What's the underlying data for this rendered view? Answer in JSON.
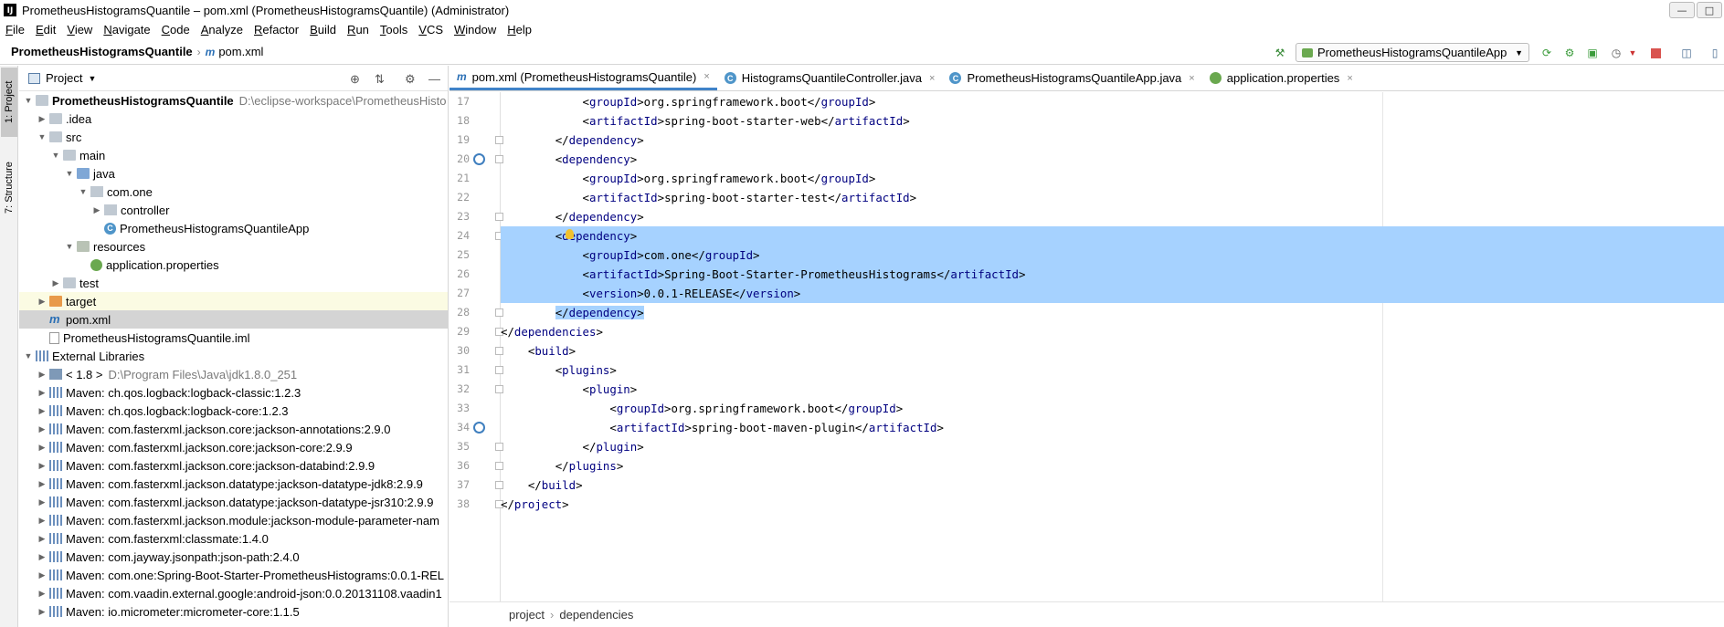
{
  "window": {
    "title": "PrometheusHistogramsQuantile – pom.xml (PrometheusHistogramsQuantile) (Administrator)",
    "minimize": "—",
    "maximize": "□"
  },
  "menu": [
    "File",
    "Edit",
    "View",
    "Navigate",
    "Code",
    "Analyze",
    "Refactor",
    "Build",
    "Run",
    "Tools",
    "VCS",
    "Window",
    "Help"
  ],
  "navbar": {
    "project": "PrometheusHistogramsQuantile",
    "separator": "›",
    "file_icon": "m",
    "file": "pom.xml",
    "run_config": "PrometheusHistogramsQuantileApp"
  },
  "toolbar_icons": [
    "hammer-icon",
    "rerun-icon",
    "debug-icon",
    "coverage-icon",
    "profile-icon",
    "stop-icon",
    "project-structure-icon",
    "terminal-icon"
  ],
  "stripe": {
    "project": "1: Project",
    "structure": "7: Structure"
  },
  "project_panel": {
    "title": "Project",
    "tree": [
      {
        "label": "PrometheusHistogramsQuantile",
        "extra": "D:\\eclipse-workspace\\PrometheusHisto",
        "level": 0,
        "arrow": "▼",
        "icon": "folder",
        "bold": true
      },
      {
        "label": ".idea",
        "level": 1,
        "arrow": "▶",
        "icon": "folder"
      },
      {
        "label": "src",
        "level": 1,
        "arrow": "▼",
        "icon": "folder"
      },
      {
        "label": "main",
        "level": 2,
        "arrow": "▼",
        "icon": "folder"
      },
      {
        "label": "java",
        "level": 3,
        "arrow": "▼",
        "icon": "folder blue"
      },
      {
        "label": "com.one",
        "level": 4,
        "arrow": "▼",
        "icon": "pkg"
      },
      {
        "label": "controller",
        "level": 5,
        "arrow": "▶",
        "icon": "pkg"
      },
      {
        "label": "PrometheusHistogramsQuantileApp",
        "level": 5,
        "arrow": "",
        "icon": "cls"
      },
      {
        "label": "resources",
        "level": 3,
        "arrow": "▼",
        "icon": "folder res"
      },
      {
        "label": "application.properties",
        "level": 4,
        "arrow": "",
        "icon": "props"
      },
      {
        "label": "test",
        "level": 2,
        "arrow": "▶",
        "icon": "folder"
      },
      {
        "label": "target",
        "level": 1,
        "arrow": "▶",
        "icon": "folder orange",
        "highlight": true
      },
      {
        "label": "pom.xml",
        "level": 1,
        "arrow": "",
        "icon": "mvn",
        "selected": true
      },
      {
        "label": "PrometheusHistogramsQuantile.iml",
        "level": 1,
        "arrow": "",
        "icon": "iml"
      },
      {
        "label": "External Libraries",
        "level": 0,
        "arrow": "▼",
        "icon": "lib"
      },
      {
        "label": "< 1.8 >",
        "extra": "D:\\Program Files\\Java\\jdk1.8.0_251",
        "level": 1,
        "arrow": "▶",
        "icon": "jdk"
      },
      {
        "label": "Maven: ch.qos.logback:logback-classic:1.2.3",
        "level": 1,
        "arrow": "▶",
        "icon": "lib"
      },
      {
        "label": "Maven: ch.qos.logback:logback-core:1.2.3",
        "level": 1,
        "arrow": "▶",
        "icon": "lib"
      },
      {
        "label": "Maven: com.fasterxml.jackson.core:jackson-annotations:2.9.0",
        "level": 1,
        "arrow": "▶",
        "icon": "lib"
      },
      {
        "label": "Maven: com.fasterxml.jackson.core:jackson-core:2.9.9",
        "level": 1,
        "arrow": "▶",
        "icon": "lib"
      },
      {
        "label": "Maven: com.fasterxml.jackson.core:jackson-databind:2.9.9",
        "level": 1,
        "arrow": "▶",
        "icon": "lib"
      },
      {
        "label": "Maven: com.fasterxml.jackson.datatype:jackson-datatype-jdk8:2.9.9",
        "level": 1,
        "arrow": "▶",
        "icon": "lib"
      },
      {
        "label": "Maven: com.fasterxml.jackson.datatype:jackson-datatype-jsr310:2.9.9",
        "level": 1,
        "arrow": "▶",
        "icon": "lib"
      },
      {
        "label": "Maven: com.fasterxml.jackson.module:jackson-module-parameter-nam",
        "level": 1,
        "arrow": "▶",
        "icon": "lib"
      },
      {
        "label": "Maven: com.fasterxml:classmate:1.4.0",
        "level": 1,
        "arrow": "▶",
        "icon": "lib"
      },
      {
        "label": "Maven: com.jayway.jsonpath:json-path:2.4.0",
        "level": 1,
        "arrow": "▶",
        "icon": "lib"
      },
      {
        "label": "Maven: com.one:Spring-Boot-Starter-PrometheusHistograms:0.0.1-REL",
        "level": 1,
        "arrow": "▶",
        "icon": "lib"
      },
      {
        "label": "Maven: com.vaadin.external.google:android-json:0.0.20131108.vaadin1",
        "level": 1,
        "arrow": "▶",
        "icon": "lib"
      },
      {
        "label": "Maven: io.micrometer:micrometer-core:1.1.5",
        "level": 1,
        "arrow": "▶",
        "icon": "lib"
      }
    ]
  },
  "tabs": [
    {
      "label": "pom.xml (PrometheusHistogramsQuantile)",
      "icon": "m",
      "active": true
    },
    {
      "label": "HistogramsQuantileController.java",
      "icon": "c"
    },
    {
      "label": "PrometheusHistogramsQuantileApp.java",
      "icon": "c"
    },
    {
      "label": "application.properties",
      "icon": "p"
    }
  ],
  "tab_close": "×",
  "code": [
    {
      "n": "17",
      "indent": "            ",
      "open": "groupId",
      "text": "org.springframework.boot",
      "close": "groupId"
    },
    {
      "n": "18",
      "indent": "            ",
      "open": "artifactId",
      "text": "spring-boot-starter-web",
      "close": "artifactId"
    },
    {
      "n": "19",
      "indent": "        ",
      "close_only": "dependency",
      "fold": true
    },
    {
      "n": "20",
      "indent": "        ",
      "open_only": "dependency",
      "fold": true,
      "mark": true
    },
    {
      "n": "21",
      "indent": "            ",
      "open": "groupId",
      "text": "org.springframework.boot",
      "close": "groupId"
    },
    {
      "n": "22",
      "indent": "            ",
      "open": "artifactId",
      "text": "spring-boot-starter-test",
      "close": "artifactId"
    },
    {
      "n": "23",
      "indent": "        ",
      "close_only": "dependency",
      "fold": true
    },
    {
      "n": "24",
      "indent": "        ",
      "open_only": "dependency",
      "fold": true,
      "sel": true,
      "bulb": true
    },
    {
      "n": "25",
      "indent": "            ",
      "open": "groupId",
      "text": "com.one",
      "close": "groupId",
      "sel": true
    },
    {
      "n": "26",
      "indent": "            ",
      "open": "artifactId",
      "text": "Spring-Boot-Starter-PrometheusHistograms",
      "close": "artifactId",
      "sel": true
    },
    {
      "n": "27",
      "indent": "            ",
      "open": "version",
      "text": "0.0.1-RELEASE",
      "close": "version",
      "sel": true
    },
    {
      "n": "28",
      "indent": "        ",
      "close_only": "dependency",
      "fold": true,
      "sel_partial": true
    },
    {
      "n": "29",
      "indent": "",
      "close_only": "dependencies",
      "fold": true
    },
    {
      "n": "30",
      "indent": "    ",
      "open_only": "build",
      "fold": true
    },
    {
      "n": "31",
      "indent": "        ",
      "open_only": "plugins",
      "fold": true
    },
    {
      "n": "32",
      "indent": "            ",
      "open_only": "plugin",
      "fold": true
    },
    {
      "n": "33",
      "indent": "                ",
      "open": "groupId",
      "text": "org.springframework.boot",
      "close": "groupId"
    },
    {
      "n": "34",
      "indent": "                ",
      "open": "artifactId",
      "text": "spring-boot-maven-plugin",
      "close": "artifactId",
      "mark": true
    },
    {
      "n": "35",
      "indent": "            ",
      "close_only": "plugin",
      "fold": true
    },
    {
      "n": "36",
      "indent": "        ",
      "close_only": "plugins",
      "fold": true
    },
    {
      "n": "37",
      "indent": "    ",
      "close_only": "build",
      "fold": true
    },
    {
      "n": "38",
      "indent": "",
      "close_only": "project",
      "fold": true
    }
  ],
  "editor_breadcrumb": [
    "project",
    "dependencies"
  ],
  "colors": {
    "selection": "#a6d2ff",
    "tag": "#000080",
    "active_tab_underline": "#4083c9"
  }
}
